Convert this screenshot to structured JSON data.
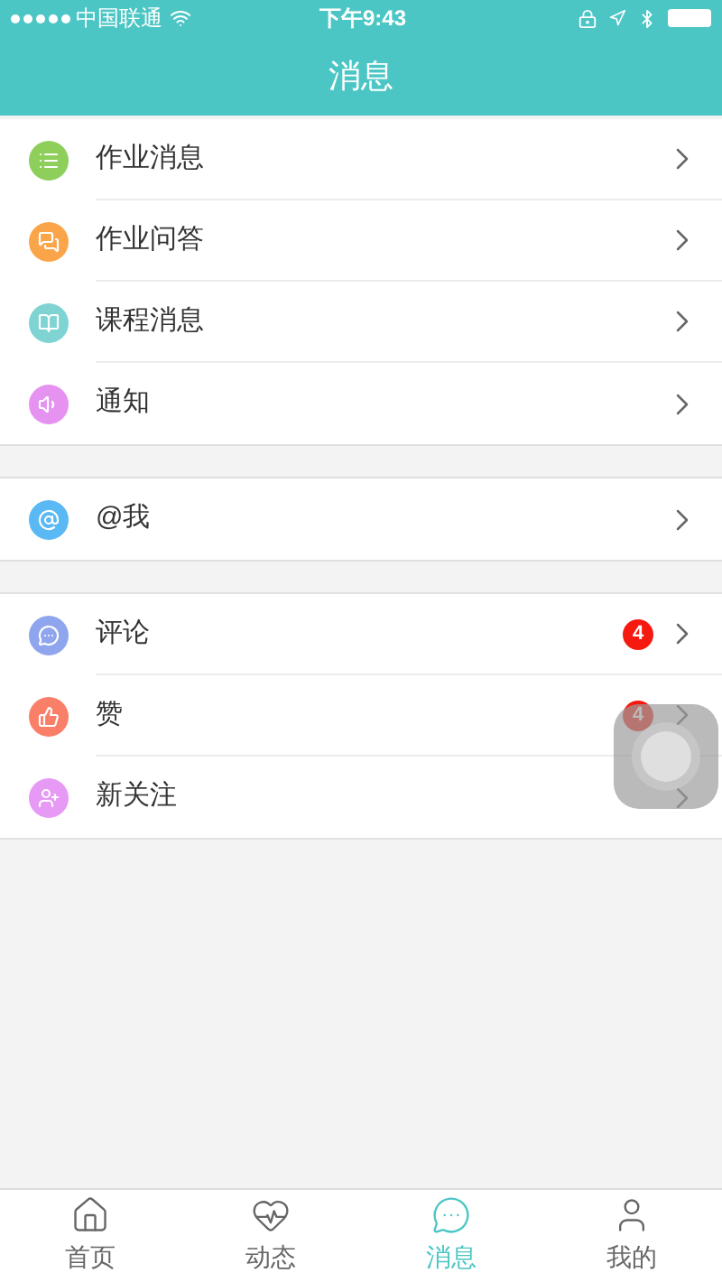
{
  "status_bar": {
    "carrier": "中国联通",
    "time": "下午9:43"
  },
  "header": {
    "title": "消息"
  },
  "sections": [
    {
      "items": [
        {
          "label": "作业消息",
          "kind": "list",
          "color": "#8dcf5a"
        },
        {
          "label": "作业问答",
          "kind": "chat",
          "color": "#fba54a"
        },
        {
          "label": "课程消息",
          "kind": "book",
          "color": "#7fd3d3"
        },
        {
          "label": "通知",
          "kind": "speaker",
          "color": "#e592f0"
        }
      ]
    },
    {
      "items": [
        {
          "label": "@我",
          "kind": "at",
          "color": "#5ab8f5"
        }
      ]
    },
    {
      "items": [
        {
          "label": "评论",
          "kind": "comment",
          "color": "#8fa5ee",
          "badge": "4"
        },
        {
          "label": "赞",
          "kind": "like",
          "color": "#f97f68",
          "badge": "4"
        },
        {
          "label": "新关注",
          "kind": "follow",
          "color": "#e79af5"
        }
      ]
    }
  ],
  "tab_bar": [
    {
      "label": "首页",
      "kind": "home",
      "selected": false
    },
    {
      "label": "动态",
      "kind": "pulse",
      "selected": false
    },
    {
      "label": "消息",
      "kind": "message",
      "selected": true
    },
    {
      "label": "我的",
      "kind": "user",
      "selected": false
    }
  ]
}
